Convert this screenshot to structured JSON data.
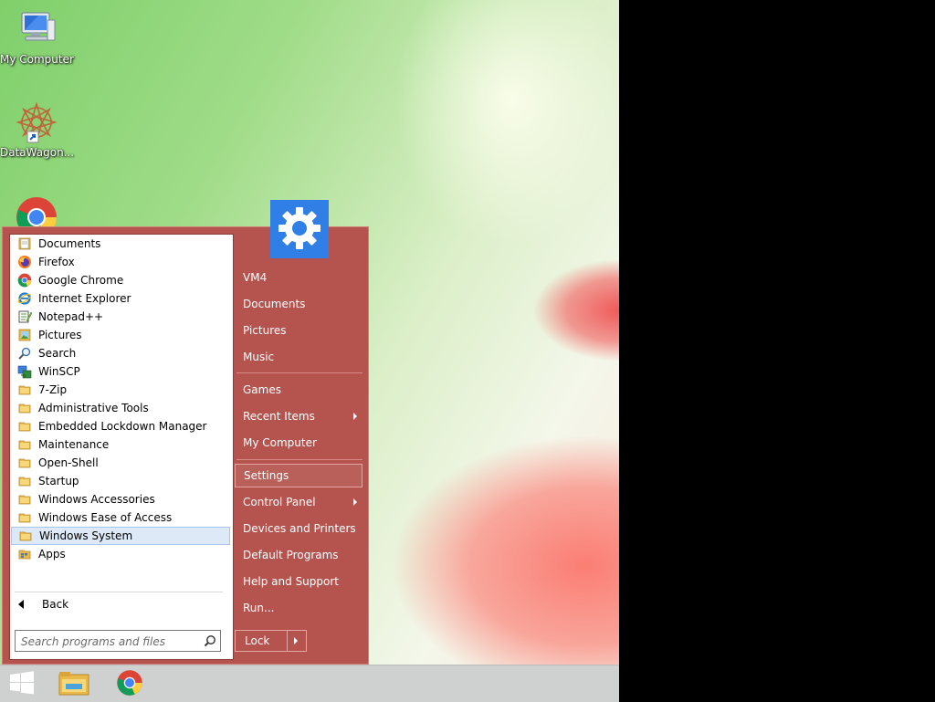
{
  "desktop": {
    "icons": [
      {
        "label": "My Computer",
        "icon": "computer-icon"
      },
      {
        "label": "DataWagon...",
        "icon": "datawagon-icon"
      },
      {
        "label": "",
        "icon": "chrome-icon"
      }
    ]
  },
  "start_menu": {
    "programs": [
      {
        "label": "Documents",
        "icon": "documents-folder-icon"
      },
      {
        "label": "Firefox",
        "icon": "firefox-icon"
      },
      {
        "label": "Google Chrome",
        "icon": "chrome-icon"
      },
      {
        "label": "Internet Explorer",
        "icon": "internet-explorer-icon"
      },
      {
        "label": "Notepad++",
        "icon": "notepad-plus-plus-icon"
      },
      {
        "label": "Pictures",
        "icon": "pictures-folder-icon"
      },
      {
        "label": "Search",
        "icon": "search-icon"
      },
      {
        "label": "WinSCP",
        "icon": "winscp-icon"
      },
      {
        "label": "7-Zip",
        "icon": "folder-icon"
      },
      {
        "label": "Administrative Tools",
        "icon": "folder-icon"
      },
      {
        "label": "Embedded Lockdown Manager",
        "icon": "folder-icon"
      },
      {
        "label": "Maintenance",
        "icon": "folder-icon"
      },
      {
        "label": "Open-Shell",
        "icon": "folder-icon"
      },
      {
        "label": "Startup",
        "icon": "folder-icon"
      },
      {
        "label": "Windows Accessories",
        "icon": "folder-icon"
      },
      {
        "label": "Windows Ease of Access",
        "icon": "folder-icon"
      },
      {
        "label": "Windows System",
        "icon": "folder-icon",
        "selected": true
      },
      {
        "label": "Apps",
        "icon": "apps-folder-icon"
      }
    ],
    "back_label": "Back",
    "search_placeholder": "Search programs and files",
    "right_items": [
      {
        "label": "VM4"
      },
      {
        "label": "Documents"
      },
      {
        "label": "Pictures"
      },
      {
        "label": "Music"
      },
      {
        "label": "Games"
      },
      {
        "label": "Recent Items",
        "has_submenu": true
      },
      {
        "label": "My Computer"
      },
      {
        "label": "Settings",
        "highlighted": true
      },
      {
        "label": "Control Panel",
        "has_submenu": true
      },
      {
        "label": "Devices and Printers"
      },
      {
        "label": "Default Programs"
      },
      {
        "label": "Help and Support"
      },
      {
        "label": "Run..."
      }
    ],
    "lock_label": "Lock",
    "user_picture_icon": "gear-icon",
    "colors": {
      "menu_bg": "#b5544f",
      "user_tile": "#2f7fe6",
      "selection": "#dde9f7"
    }
  },
  "taskbar": {
    "items": [
      {
        "name": "start-button",
        "icon": "windows-logo-icon"
      },
      {
        "name": "file-explorer",
        "icon": "file-explorer-icon"
      },
      {
        "name": "google-chrome",
        "icon": "chrome-icon"
      }
    ]
  }
}
